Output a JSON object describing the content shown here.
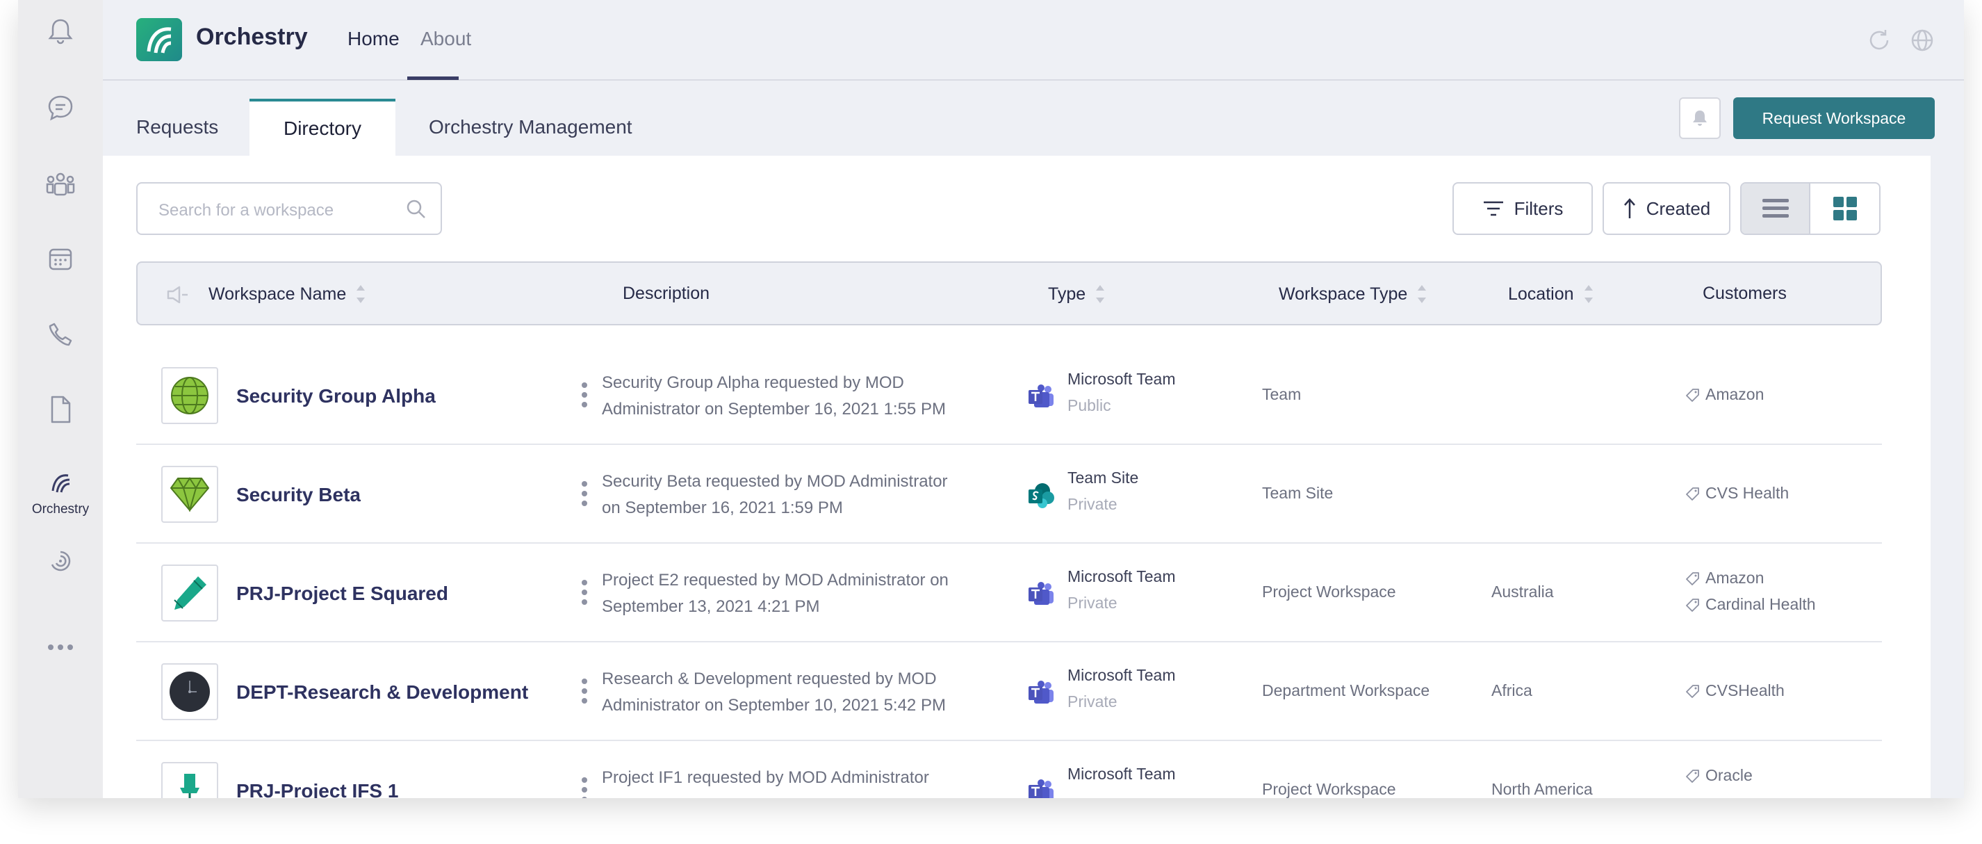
{
  "app": {
    "title": "Orchestry"
  },
  "nav": {
    "home": "Home",
    "about": "About"
  },
  "rail": {
    "orchestry_label": "Orchestry"
  },
  "tabs": [
    {
      "label": "Requests",
      "active": false
    },
    {
      "label": "Directory",
      "active": true
    },
    {
      "label": "Orchestry Management",
      "active": false
    }
  ],
  "actions": {
    "request_workspace": "Request Workspace"
  },
  "search": {
    "placeholder": "Search for a workspace"
  },
  "toolbar": {
    "filters": "Filters",
    "sort": "Created"
  },
  "columns": {
    "name": "Workspace Name",
    "description": "Description",
    "type": "Type",
    "workspace_type": "Workspace Type",
    "location": "Location",
    "customers": "Customers"
  },
  "rows": [
    {
      "name": "Security Group Alpha",
      "icon": "globe-icon",
      "description": "Security Group Alpha requested by MOD Administrator on September 16, 2021 1:55 PM",
      "type": "Microsoft Team",
      "privacy": "Public",
      "workspace_type": "Team",
      "location": "",
      "customers": [
        "Amazon"
      ]
    },
    {
      "name": "Security Beta",
      "icon": "diamond-icon",
      "description": "Security Beta requested by MOD Administrator on September 16, 2021 1:59 PM",
      "type": "Team Site",
      "privacy": "Private",
      "workspace_type": "Team Site",
      "location": "",
      "customers": [
        "CVS Health"
      ]
    },
    {
      "name": "PRJ-Project E Squared",
      "icon": "pencil-icon",
      "description": "Project E2 requested by MOD Administrator on September 13, 2021 4:21 PM",
      "type": "Microsoft Team",
      "privacy": "Private",
      "workspace_type": "Project Workspace",
      "location": "Australia",
      "customers": [
        "Amazon",
        "Cardinal Health"
      ]
    },
    {
      "name": "DEPT-Research & Development",
      "icon": "clock-icon",
      "description": "Research & Development requested by MOD Administrator on September 10, 2021 5:42 PM",
      "type": "Microsoft Team",
      "privacy": "Private",
      "workspace_type": "Department Workspace",
      "location": "Africa",
      "customers": [
        "CVSHealth"
      ]
    },
    {
      "name": "PRJ-Project IFS 1",
      "icon": "pushpin-icon",
      "description": "Project IF1 requested by MOD Administrator",
      "type": "Microsoft Team",
      "privacy": "",
      "workspace_type": "Project Workspace",
      "location": "North America",
      "customers": [
        "Oracle"
      ]
    }
  ],
  "colors": {
    "accent": "#2f7985",
    "tab_accent": "#2a8a93",
    "name_text": "#2e3260",
    "teams_purple": "#5059c9",
    "sharepoint_teal": "#038387"
  }
}
